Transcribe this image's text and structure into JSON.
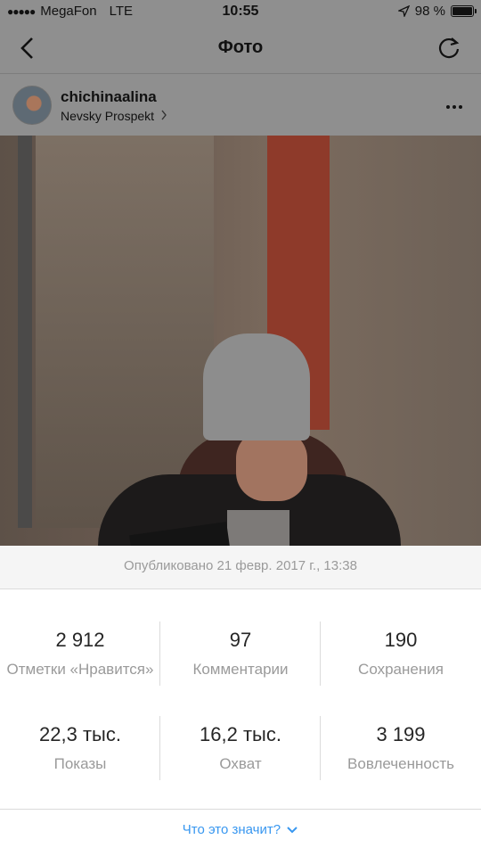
{
  "status_bar": {
    "signal_dots": "●●●●●",
    "carrier": "MegaFon",
    "network": "LTE",
    "time": "10:55",
    "battery": "98 %"
  },
  "nav": {
    "title": "Фото",
    "back_icon": "chevron-left-icon",
    "reload_icon": "refresh-icon"
  },
  "post": {
    "username": "chichinaalina",
    "location": "Nevsky Prospekt",
    "more_icon": "ellipsis-icon"
  },
  "published": "Опубликовано 21 февр. 2017 г., 13:38",
  "stats": {
    "likes": {
      "value": "2 912",
      "label": "Отметки «Нравится»"
    },
    "comments": {
      "value": "97",
      "label": "Комментарии"
    },
    "saves": {
      "value": "190",
      "label": "Сохранения"
    },
    "impressions": {
      "value": "22,3 тыс.",
      "label": "Показы"
    },
    "reach": {
      "value": "16,2 тыс.",
      "label": "Охват"
    },
    "engagement": {
      "value": "3 199",
      "label": "Вовлеченность"
    }
  },
  "footer": {
    "link": "Что это значит?"
  },
  "colors": {
    "accent": "#3897f0",
    "muted_text": "#9a9a9a",
    "overlay": "#8f8f8f"
  }
}
